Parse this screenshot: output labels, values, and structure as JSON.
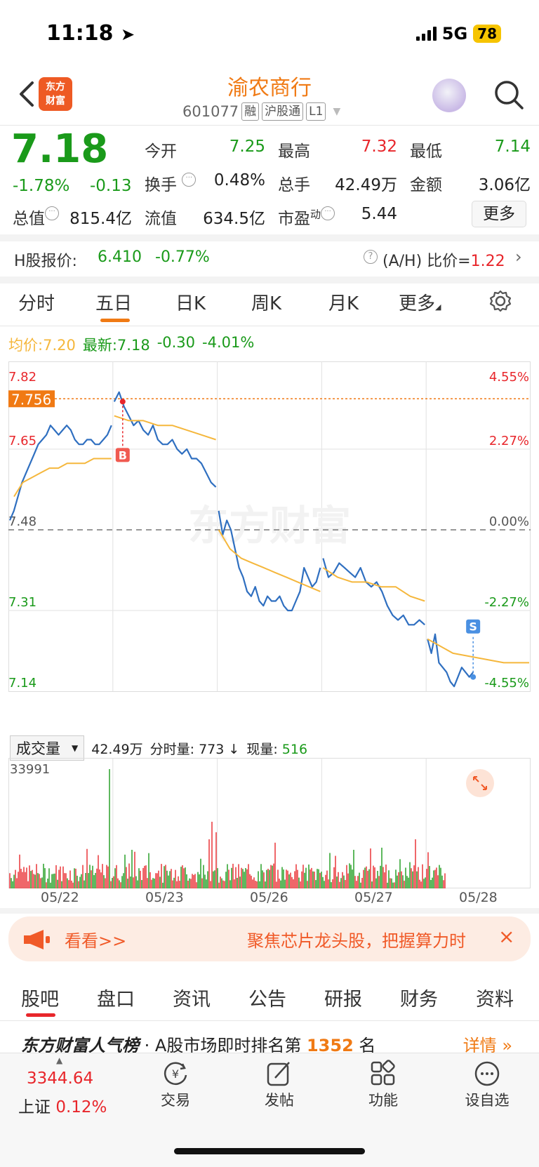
{
  "status_bar": {
    "time": "11:18",
    "network": "5G",
    "battery": "78"
  },
  "header": {
    "logo_text_1": "东方",
    "logo_text_2": "财富",
    "stock_name": "渝农商行",
    "stock_code": "601077",
    "tags": [
      "融",
      "沪股通",
      "L1"
    ]
  },
  "quote": {
    "price": "7.18",
    "change_pct": "-1.78%",
    "change_abs": "-0.13",
    "fields": {
      "open_label": "今开",
      "open": "7.25",
      "high_label": "最高",
      "high": "7.32",
      "low_label": "最低",
      "low": "7.14",
      "turnover_label": "换手",
      "turnover": "0.48%",
      "volume_label": "总手",
      "volume": "42.49万",
      "amount_label": "金额",
      "amount": "3.06亿",
      "mktcap_label": "总值",
      "mktcap": "815.4亿",
      "float_label": "流值",
      "float_cap": "634.5亿",
      "pe_label": "市盈",
      "pe_sup": "动",
      "pe": "5.44"
    },
    "more_button": "更多"
  },
  "h_share": {
    "label": "H股报价:",
    "price": "6.410",
    "change": "-0.77%",
    "ratio_label": "(A/H) 比价=",
    "ratio": "1.22"
  },
  "kline_tabs": [
    "分时",
    "五日",
    "日K",
    "周K",
    "月K",
    "更多"
  ],
  "active_tab": "五日",
  "legend": {
    "avg_label": "均价:",
    "avg_value": "7.20",
    "latest_label": "最新:",
    "latest_value": "7.18",
    "latest_change": "-0.30",
    "latest_pct": "-4.01%"
  },
  "chart_data": {
    "type": "line",
    "title": "",
    "y_ticks_left": [
      "7.82",
      "7.65",
      "7.48",
      "7.31",
      "7.14"
    ],
    "y_ticks_right": [
      "4.55%",
      "2.27%",
      "0.00%",
      "-2.27%",
      "-4.55%"
    ],
    "ylim": [
      7.14,
      7.82
    ],
    "prev_close": 7.48,
    "highlight_price": "7.756",
    "x_labels": [
      "05/22",
      "05/23",
      "05/26",
      "05/27",
      "05/28"
    ],
    "markers": {
      "buy": "B",
      "sell": "S"
    },
    "series": [
      {
        "name": "price",
        "color": "#2f6fc0",
        "days": [
          [
            7.5,
            7.52,
            7.55,
            7.58,
            7.6,
            7.62,
            7.64,
            7.66,
            7.67,
            7.68,
            7.7,
            7.69,
            7.68,
            7.69,
            7.7,
            7.69,
            7.67,
            7.66,
            7.66,
            7.67,
            7.67,
            7.66,
            7.66,
            7.67,
            7.68,
            7.7
          ],
          [
            7.75,
            7.77,
            7.74,
            7.72,
            7.7,
            7.71,
            7.69,
            7.68,
            7.7,
            7.67,
            7.66,
            7.66,
            7.67,
            7.65,
            7.64,
            7.65,
            7.63,
            7.63,
            7.62,
            7.6,
            7.58,
            7.57
          ],
          [
            7.52,
            7.47,
            7.5,
            7.48,
            7.44,
            7.4,
            7.38,
            7.35,
            7.34,
            7.36,
            7.33,
            7.32,
            7.34,
            7.33,
            7.33,
            7.34,
            7.32,
            7.31,
            7.31,
            7.33,
            7.35,
            7.4,
            7.38,
            7.36,
            7.37,
            7.4
          ],
          [
            7.42,
            7.38,
            7.39,
            7.41,
            7.4,
            7.39,
            7.38,
            7.4,
            7.37,
            7.36,
            7.37,
            7.35,
            7.32,
            7.3,
            7.29,
            7.3,
            7.28,
            7.28,
            7.29,
            7.28
          ],
          [
            7.25,
            7.22,
            7.26,
            7.2,
            7.19,
            7.18,
            7.16,
            7.15,
            7.17,
            7.19,
            7.18,
            7.17,
            7.18
          ]
        ]
      },
      {
        "name": "avg",
        "color": "#f5b73c",
        "days": [
          [
            7.55,
            7.58,
            7.59,
            7.6,
            7.61,
            7.61,
            7.62,
            7.62,
            7.62,
            7.63,
            7.63,
            7.63
          ],
          [
            7.72,
            7.71,
            7.71,
            7.7,
            7.7,
            7.69,
            7.68,
            7.67
          ],
          [
            7.48,
            7.44,
            7.42,
            7.41,
            7.4,
            7.39,
            7.38,
            7.37,
            7.36,
            7.35
          ],
          [
            7.4,
            7.38,
            7.37,
            7.37,
            7.36,
            7.36,
            7.34,
            7.33
          ],
          [
            7.25,
            7.22,
            7.21,
            7.2,
            7.2
          ]
        ]
      }
    ]
  },
  "volume": {
    "selector": "成交量",
    "total": "42.49万",
    "minute_label": "分时量:",
    "minute_value": "773",
    "arrow": "↓",
    "current_label": "现量:",
    "current_value": "516",
    "max_tick": "33991"
  },
  "banner": {
    "left_text": "看看>>",
    "right_text": "聚焦芯片龙头股，把握算力时"
  },
  "bottom_tabs": [
    "股吧",
    "盘口",
    "资讯",
    "公告",
    "研报",
    "财务",
    "资料"
  ],
  "rank": {
    "title": "东方财富人气榜",
    "text": "· A股市场即时排名第",
    "number": "1352",
    "unit": "名",
    "detail": "详情"
  },
  "index": {
    "value": "3344.64",
    "name": "上证",
    "change": "0.12%"
  },
  "nav": [
    "交易",
    "发帖",
    "功能",
    "设自选"
  ],
  "watermark": "东方财富",
  "colors": {
    "accent": "#f07a14",
    "up": "#e8262b",
    "down": "#1a9a1a",
    "line": "#2f6fc0"
  }
}
